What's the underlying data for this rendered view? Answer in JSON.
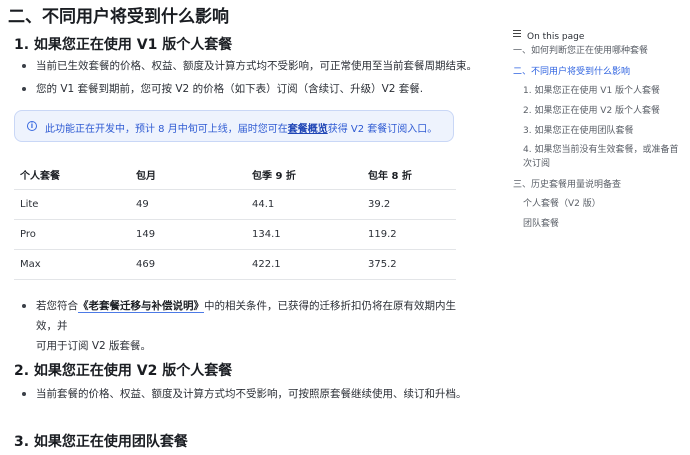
{
  "heading_main": "二、不同用户将受到什么影响",
  "section1": {
    "title": "1. 如果您正在使用 V1 版个人套餐",
    "bullets": [
      "当前已生效套餐的价格、权益、额度及计算方式均不受影响，可正常使用至当前套餐周期结束。",
      "您的 V1 套餐到期前，您可按 V2 的价格（如下表）订阅（含续订、升级）V2 套餐."
    ],
    "notice": {
      "icon": "info-icon",
      "before": "此功能正在开发中，预计 8 月中旬可上线，届时您可在",
      "link": "套餐概览",
      "after": "获得 V2 套餐订阅入口。"
    },
    "table": {
      "headers": [
        "个人套餐",
        "包月",
        "包季 9 折",
        "包年 8 折"
      ],
      "rows": [
        [
          "Lite",
          "49",
          "44.1",
          "39.2"
        ],
        [
          "Pro",
          "149",
          "134.1",
          "119.2"
        ],
        [
          "Max",
          "469",
          "422.1",
          "375.2"
        ]
      ]
    },
    "bullet3": {
      "before": "若您符合",
      "link": "《老套餐迁移与补偿说明》",
      "line1_after": "中的相关条件，已获得的迁移折扣仍将在原有效期内生效，并",
      "line2": "可用于订阅 V2 版套餐。"
    }
  },
  "section2": {
    "title": "2. 如果您正在使用 V2 版个人套餐",
    "bullets": [
      "当前套餐的价格、权益、额度及计算方式均不受影响，可按照原套餐继续使用、续订和升档。"
    ]
  },
  "section3": {
    "title": "3. 如果您正在使用团队套餐"
  },
  "toc": {
    "title": "On this page",
    "items": [
      {
        "label": "一、如何判断您正在使用哪种套餐"
      },
      {
        "label": "二、不同用户将受到什么影响"
      },
      {
        "label": "1. 如果您正在使用 V1 版个人套餐"
      },
      {
        "label": "2. 如果您正在使用 V2 版个人套餐"
      },
      {
        "label": "3. 如果您正在使用团队套餐"
      },
      {
        "label": "4. 如果您当前没有生效套餐，或准备首"
      },
      {
        "label": "次订阅"
      },
      {
        "label": "三、历史套餐用量说明备查"
      },
      {
        "label": "个人套餐（V2 版）"
      },
      {
        "label": "团队套餐"
      }
    ],
    "active_color": "#2f63e0"
  }
}
